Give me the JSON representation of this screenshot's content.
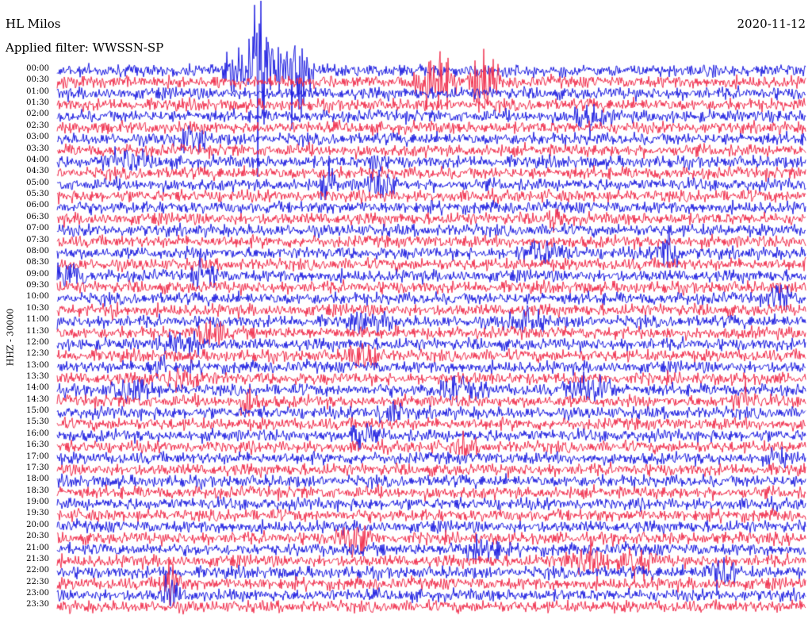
{
  "header": {
    "station": "HL Milos",
    "filter": "Applied filter: WWSSN-SP",
    "date": "2020-11-12"
  },
  "channel_label": "HHZ - 30000",
  "colors": {
    "trace_a": "#1f1fe0",
    "trace_b": "#f0304e",
    "background": "#ffffff",
    "text": "#000000"
  },
  "rows": [
    {
      "label": "00:00"
    },
    {
      "label": "00:30"
    },
    {
      "label": "01:00"
    },
    {
      "label": "01:30"
    },
    {
      "label": "02:00"
    },
    {
      "label": "02:30"
    },
    {
      "label": "03:00"
    },
    {
      "label": "03:30"
    },
    {
      "label": "04:00"
    },
    {
      "label": "04:30"
    },
    {
      "label": "05:00"
    },
    {
      "label": "05:30"
    },
    {
      "label": "06:00"
    },
    {
      "label": "06:30"
    },
    {
      "label": "07:00"
    },
    {
      "label": "07:30"
    },
    {
      "label": "08:00"
    },
    {
      "label": "08:30"
    },
    {
      "label": "09:00"
    },
    {
      "label": "09:30"
    },
    {
      "label": "10:00"
    },
    {
      "label": "10:30"
    },
    {
      "label": "11:00"
    },
    {
      "label": "11:30"
    },
    {
      "label": "12:00"
    },
    {
      "label": "12:30"
    },
    {
      "label": "13:00"
    },
    {
      "label": "13:30"
    },
    {
      "label": "14:00"
    },
    {
      "label": "14:30"
    },
    {
      "label": "15:00"
    },
    {
      "label": "15:30"
    },
    {
      "label": "16:00"
    },
    {
      "label": "16:30"
    },
    {
      "label": "17:00"
    },
    {
      "label": "17:30"
    },
    {
      "label": "18:00"
    },
    {
      "label": "18:30"
    },
    {
      "label": "19:00"
    },
    {
      "label": "19:30"
    },
    {
      "label": "20:00"
    },
    {
      "label": "20:30"
    },
    {
      "label": "21:00"
    },
    {
      "label": "21:30"
    },
    {
      "label": "22:00"
    },
    {
      "label": "22:30"
    },
    {
      "label": "23:00"
    },
    {
      "label": "23:30"
    }
  ]
}
